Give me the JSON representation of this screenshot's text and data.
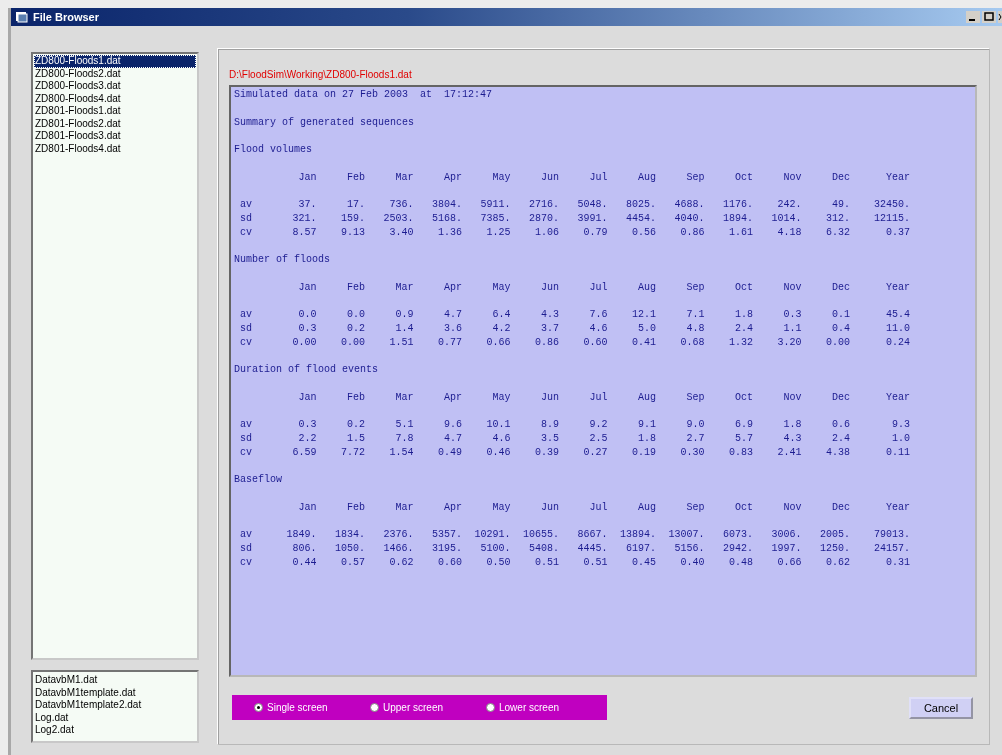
{
  "window": {
    "title": "File Browser"
  },
  "file_list": [
    {
      "label": "ZD800-Floods1.dat",
      "selected": true
    },
    {
      "label": "ZD800-Floods2.dat",
      "selected": false
    },
    {
      "label": "ZD800-Floods3.dat",
      "selected": false
    },
    {
      "label": "ZD800-Floods4.dat",
      "selected": false
    },
    {
      "label": "ZD801-Floods1.dat",
      "selected": false
    },
    {
      "label": "ZD801-Floods2.dat",
      "selected": false
    },
    {
      "label": "ZD801-Floods3.dat",
      "selected": false
    },
    {
      "label": "ZD801-Floods4.dat",
      "selected": false
    }
  ],
  "other_files": [
    {
      "label": "DatavbM1.dat",
      "selected": false
    },
    {
      "label": "DatavbM1template.dat",
      "selected": false
    },
    {
      "label": "DatavbM1template2.dat",
      "selected": false
    },
    {
      "label": "Log.dat",
      "selected": false
    },
    {
      "label": "Log2.dat",
      "selected": false
    }
  ],
  "path": "D:\\FloodSim\\Working\\ZD800-Floods1.dat",
  "report": {
    "header_line": "Simulated data on 27 Feb 2003  at  17:12:47",
    "subtitle": "Summary of generated sequences",
    "sections": [
      {
        "title": "Flood volumes",
        "columns": [
          "Jan",
          "Feb",
          "Mar",
          "Apr",
          "May",
          "Jun",
          "Jul",
          "Aug",
          "Sep",
          "Oct",
          "Nov",
          "Dec",
          "Year"
        ],
        "rows": [
          {
            "label": "av",
            "values": [
              "37.",
              "17.",
              "736.",
              "3804.",
              "5911.",
              "2716.",
              "5048.",
              "8025.",
              "4688.",
              "1176.",
              "242.",
              "49.",
              "32450."
            ]
          },
          {
            "label": "sd",
            "values": [
              "321.",
              "159.",
              "2503.",
              "5168.",
              "7385.",
              "2870.",
              "3991.",
              "4454.",
              "4040.",
              "1894.",
              "1014.",
              "312.",
              "12115."
            ]
          },
          {
            "label": "cv",
            "values": [
              "8.57",
              "9.13",
              "3.40",
              "1.36",
              "1.25",
              "1.06",
              "0.79",
              "0.56",
              "0.86",
              "1.61",
              "4.18",
              "6.32",
              "0.37"
            ]
          }
        ]
      },
      {
        "title": "Number of floods",
        "columns": [
          "Jan",
          "Feb",
          "Mar",
          "Apr",
          "May",
          "Jun",
          "Jul",
          "Aug",
          "Sep",
          "Oct",
          "Nov",
          "Dec",
          "Year"
        ],
        "rows": [
          {
            "label": "av",
            "values": [
              "0.0",
              "0.0",
              "0.9",
              "4.7",
              "6.4",
              "4.3",
              "7.6",
              "12.1",
              "7.1",
              "1.8",
              "0.3",
              "0.1",
              "45.4"
            ]
          },
          {
            "label": "sd",
            "values": [
              "0.3",
              "0.2",
              "1.4",
              "3.6",
              "4.2",
              "3.7",
              "4.6",
              "5.0",
              "4.8",
              "2.4",
              "1.1",
              "0.4",
              "11.0"
            ]
          },
          {
            "label": "cv",
            "values": [
              "0.00",
              "0.00",
              "1.51",
              "0.77",
              "0.66",
              "0.86",
              "0.60",
              "0.41",
              "0.68",
              "1.32",
              "3.20",
              "0.00",
              "0.24"
            ]
          }
        ]
      },
      {
        "title": "Duration of flood events",
        "columns": [
          "Jan",
          "Feb",
          "Mar",
          "Apr",
          "May",
          "Jun",
          "Jul",
          "Aug",
          "Sep",
          "Oct",
          "Nov",
          "Dec",
          "Year"
        ],
        "rows": [
          {
            "label": "av",
            "values": [
              "0.3",
              "0.2",
              "5.1",
              "9.6",
              "10.1",
              "8.9",
              "9.2",
              "9.1",
              "9.0",
              "6.9",
              "1.8",
              "0.6",
              "9.3"
            ]
          },
          {
            "label": "sd",
            "values": [
              "2.2",
              "1.5",
              "7.8",
              "4.7",
              "4.6",
              "3.5",
              "2.5",
              "1.8",
              "2.7",
              "5.7",
              "4.3",
              "2.4",
              "1.0"
            ]
          },
          {
            "label": "cv",
            "values": [
              "6.59",
              "7.72",
              "1.54",
              "0.49",
              "0.46",
              "0.39",
              "0.27",
              "0.19",
              "0.30",
              "0.83",
              "2.41",
              "4.38",
              "0.11"
            ]
          }
        ]
      },
      {
        "title": "Baseflow",
        "columns": [
          "Jan",
          "Feb",
          "Mar",
          "Apr",
          "May",
          "Jun",
          "Jul",
          "Aug",
          "Sep",
          "Oct",
          "Nov",
          "Dec",
          "Year"
        ],
        "rows": [
          {
            "label": "av",
            "values": [
              "1849.",
              "1834.",
              "2376.",
              "5357.",
              "10291.",
              "10655.",
              "8667.",
              "13894.",
              "13007.",
              "6073.",
              "3006.",
              "2005.",
              "79013."
            ]
          },
          {
            "label": "sd",
            "values": [
              "806.",
              "1050.",
              "1466.",
              "3195.",
              "5100.",
              "5408.",
              "4445.",
              "6197.",
              "5156.",
              "2942.",
              "1997.",
              "1250.",
              "24157."
            ]
          },
          {
            "label": "cv",
            "values": [
              "0.44",
              "0.57",
              "0.62",
              "0.60",
              "0.50",
              "0.51",
              "0.51",
              "0.45",
              "0.40",
              "0.48",
              "0.66",
              "0.62",
              "0.31"
            ]
          }
        ]
      }
    ]
  },
  "view_options": [
    {
      "label": "Single screen",
      "selected": true
    },
    {
      "label": "Upper screen",
      "selected": false
    },
    {
      "label": "Lower screen",
      "selected": false
    }
  ],
  "cancel_button": "Cancel"
}
